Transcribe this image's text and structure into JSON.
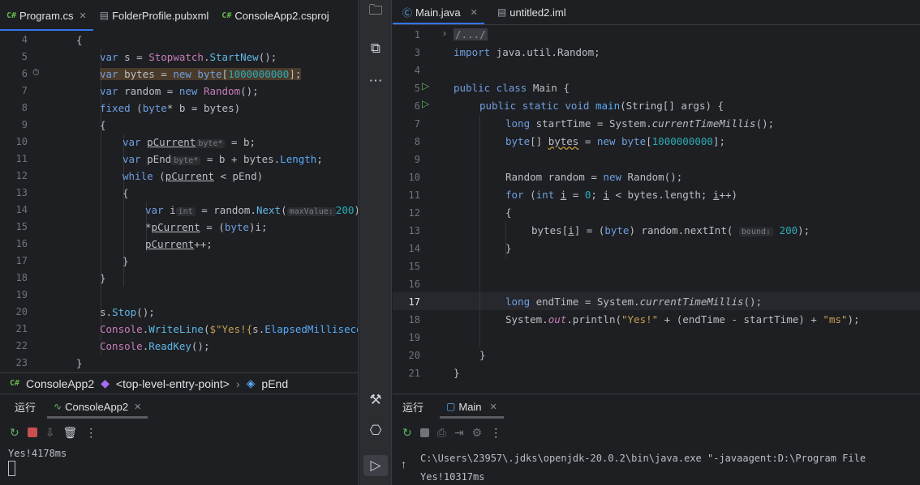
{
  "left": {
    "tabs": [
      {
        "icon": "C#",
        "label": "Program.cs",
        "active": true
      },
      {
        "icon": "pub",
        "label": "FolderProfile.pubxml",
        "active": false
      },
      {
        "icon": "C#",
        "label": "ConsoleApp2.csproj",
        "active": false
      }
    ],
    "breadcrumb": {
      "project": "ConsoleApp2",
      "entry": "<top-level-entry-point>",
      "symbol": "pEnd"
    },
    "run": {
      "tab_run": "运行",
      "tab_config": "ConsoleApp2",
      "output": "Yes!4178ms"
    },
    "hints": {
      "bytep1": "byte*",
      "bytep2": "byte*",
      "int": "int",
      "maxValue": "maxValue:"
    }
  },
  "right": {
    "tabs": [
      {
        "label": "Main.java",
        "active": true
      },
      {
        "label": "untitled2.iml",
        "active": false
      }
    ],
    "fold_text": "/.../",
    "hints": {
      "bound": "bound:"
    },
    "run": {
      "tab_run": "运行",
      "tab_config": "Main",
      "cmd": "C:\\Users\\23957\\.jdks\\openjdk-20.0.2\\bin\\java.exe \"-javaagent:D:\\Program File",
      "output": "Yes!10317ms"
    }
  },
  "left_line_numbers": [
    "4",
    "5",
    "6",
    "7",
    "8",
    "9",
    "10",
    "11",
    "12",
    "13",
    "14",
    "15",
    "16",
    "17",
    "18",
    "19",
    "20",
    "21",
    "22",
    "23"
  ],
  "right_line_numbers": [
    "1",
    "3",
    "4",
    "5",
    "6",
    "7",
    "8",
    "9",
    "10",
    "11",
    "12",
    "13",
    "14",
    "15",
    "16",
    "17",
    "18",
    "19",
    "20",
    "21"
  ],
  "colors": {
    "accent": "#3574f0",
    "keyword": "#6f9fe0",
    "number": "#2aacb8",
    "method": "#57aaf7",
    "run": "#5fb865"
  }
}
